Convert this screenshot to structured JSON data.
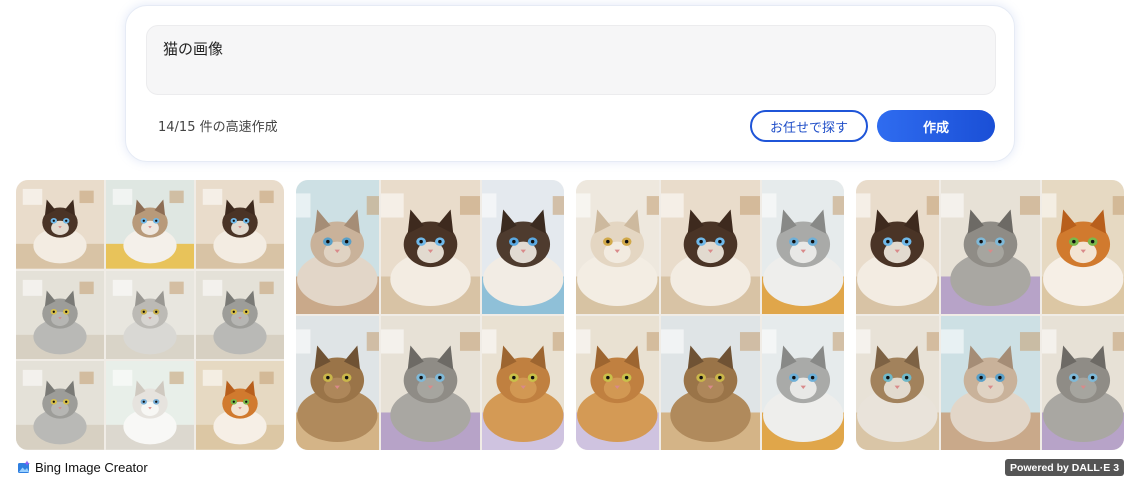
{
  "prompt": {
    "text": "猫の画像",
    "boost_status": "14/15 件の高速作成",
    "surprise_label": "お任せで探す",
    "create_label": "作成"
  },
  "results": [
    {
      "layout": "grid-3x3",
      "cells": [
        "himalayan",
        "ragdoll",
        "himalayan",
        "silver-tabby",
        "silver-persian",
        "silver-tabby",
        "silver-tabby",
        "white-cat",
        "orange-white"
      ]
    },
    {
      "layout": "grid-2x3",
      "cells": [
        "living-room",
        "himalayan",
        "siamese",
        "brown-tabby",
        "gray-tabby",
        "orange-tabby"
      ]
    },
    {
      "layout": "grid-2x3",
      "cells": [
        "cream-persian",
        "himalayan",
        "gray-white",
        "orange-tabby",
        "brown-tabby",
        "gray-white"
      ]
    },
    {
      "layout": "grid-2x3",
      "cells": [
        "himalayan",
        "gray-tabby",
        "orange-white",
        "tabby-white",
        "living-room",
        "gray-tabby"
      ]
    }
  ],
  "footer": {
    "brand": "Bing Image Creator",
    "badge": "Powered by DALL·E 3"
  },
  "colors": {
    "accent": "#1f55d8",
    "badge_bg": "#555555"
  }
}
